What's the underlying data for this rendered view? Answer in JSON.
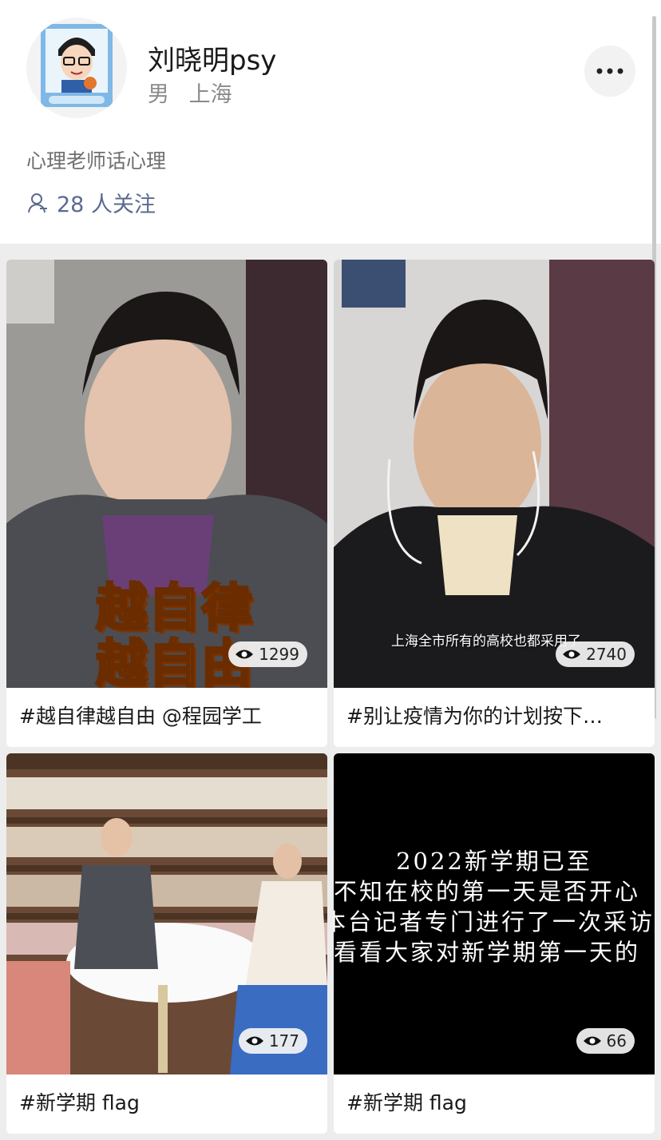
{
  "profile": {
    "name": "刘晓明psy",
    "gender": "男",
    "location": "上海",
    "bio": "心理老师话心理",
    "followers": "28 人关注"
  },
  "icons": {
    "more": "more-dots-icon",
    "followers": "person-icon",
    "views": "eye-icon"
  },
  "videos": [
    {
      "caption": "#越自律越自由 @程园学工",
      "views": "1299",
      "overlay_line1": "越自律",
      "overlay_line2": "越自由"
    },
    {
      "caption": "#别让疫情为你的计划按下…",
      "views": "2740",
      "subtitle": "上海全市所有的高校也都采用了"
    },
    {
      "caption": "#新学期 flag",
      "views": "177"
    },
    {
      "caption": "#新学期 flag",
      "views": "66",
      "text_lines": [
        "2022新学期已至",
        "不知在校的第一天是否开心",
        "本台记者专门进行了一次采访",
        "看看大家对新学期第一天的"
      ]
    }
  ],
  "colors": {
    "link": "#5b6a91",
    "background": "#ededed"
  }
}
